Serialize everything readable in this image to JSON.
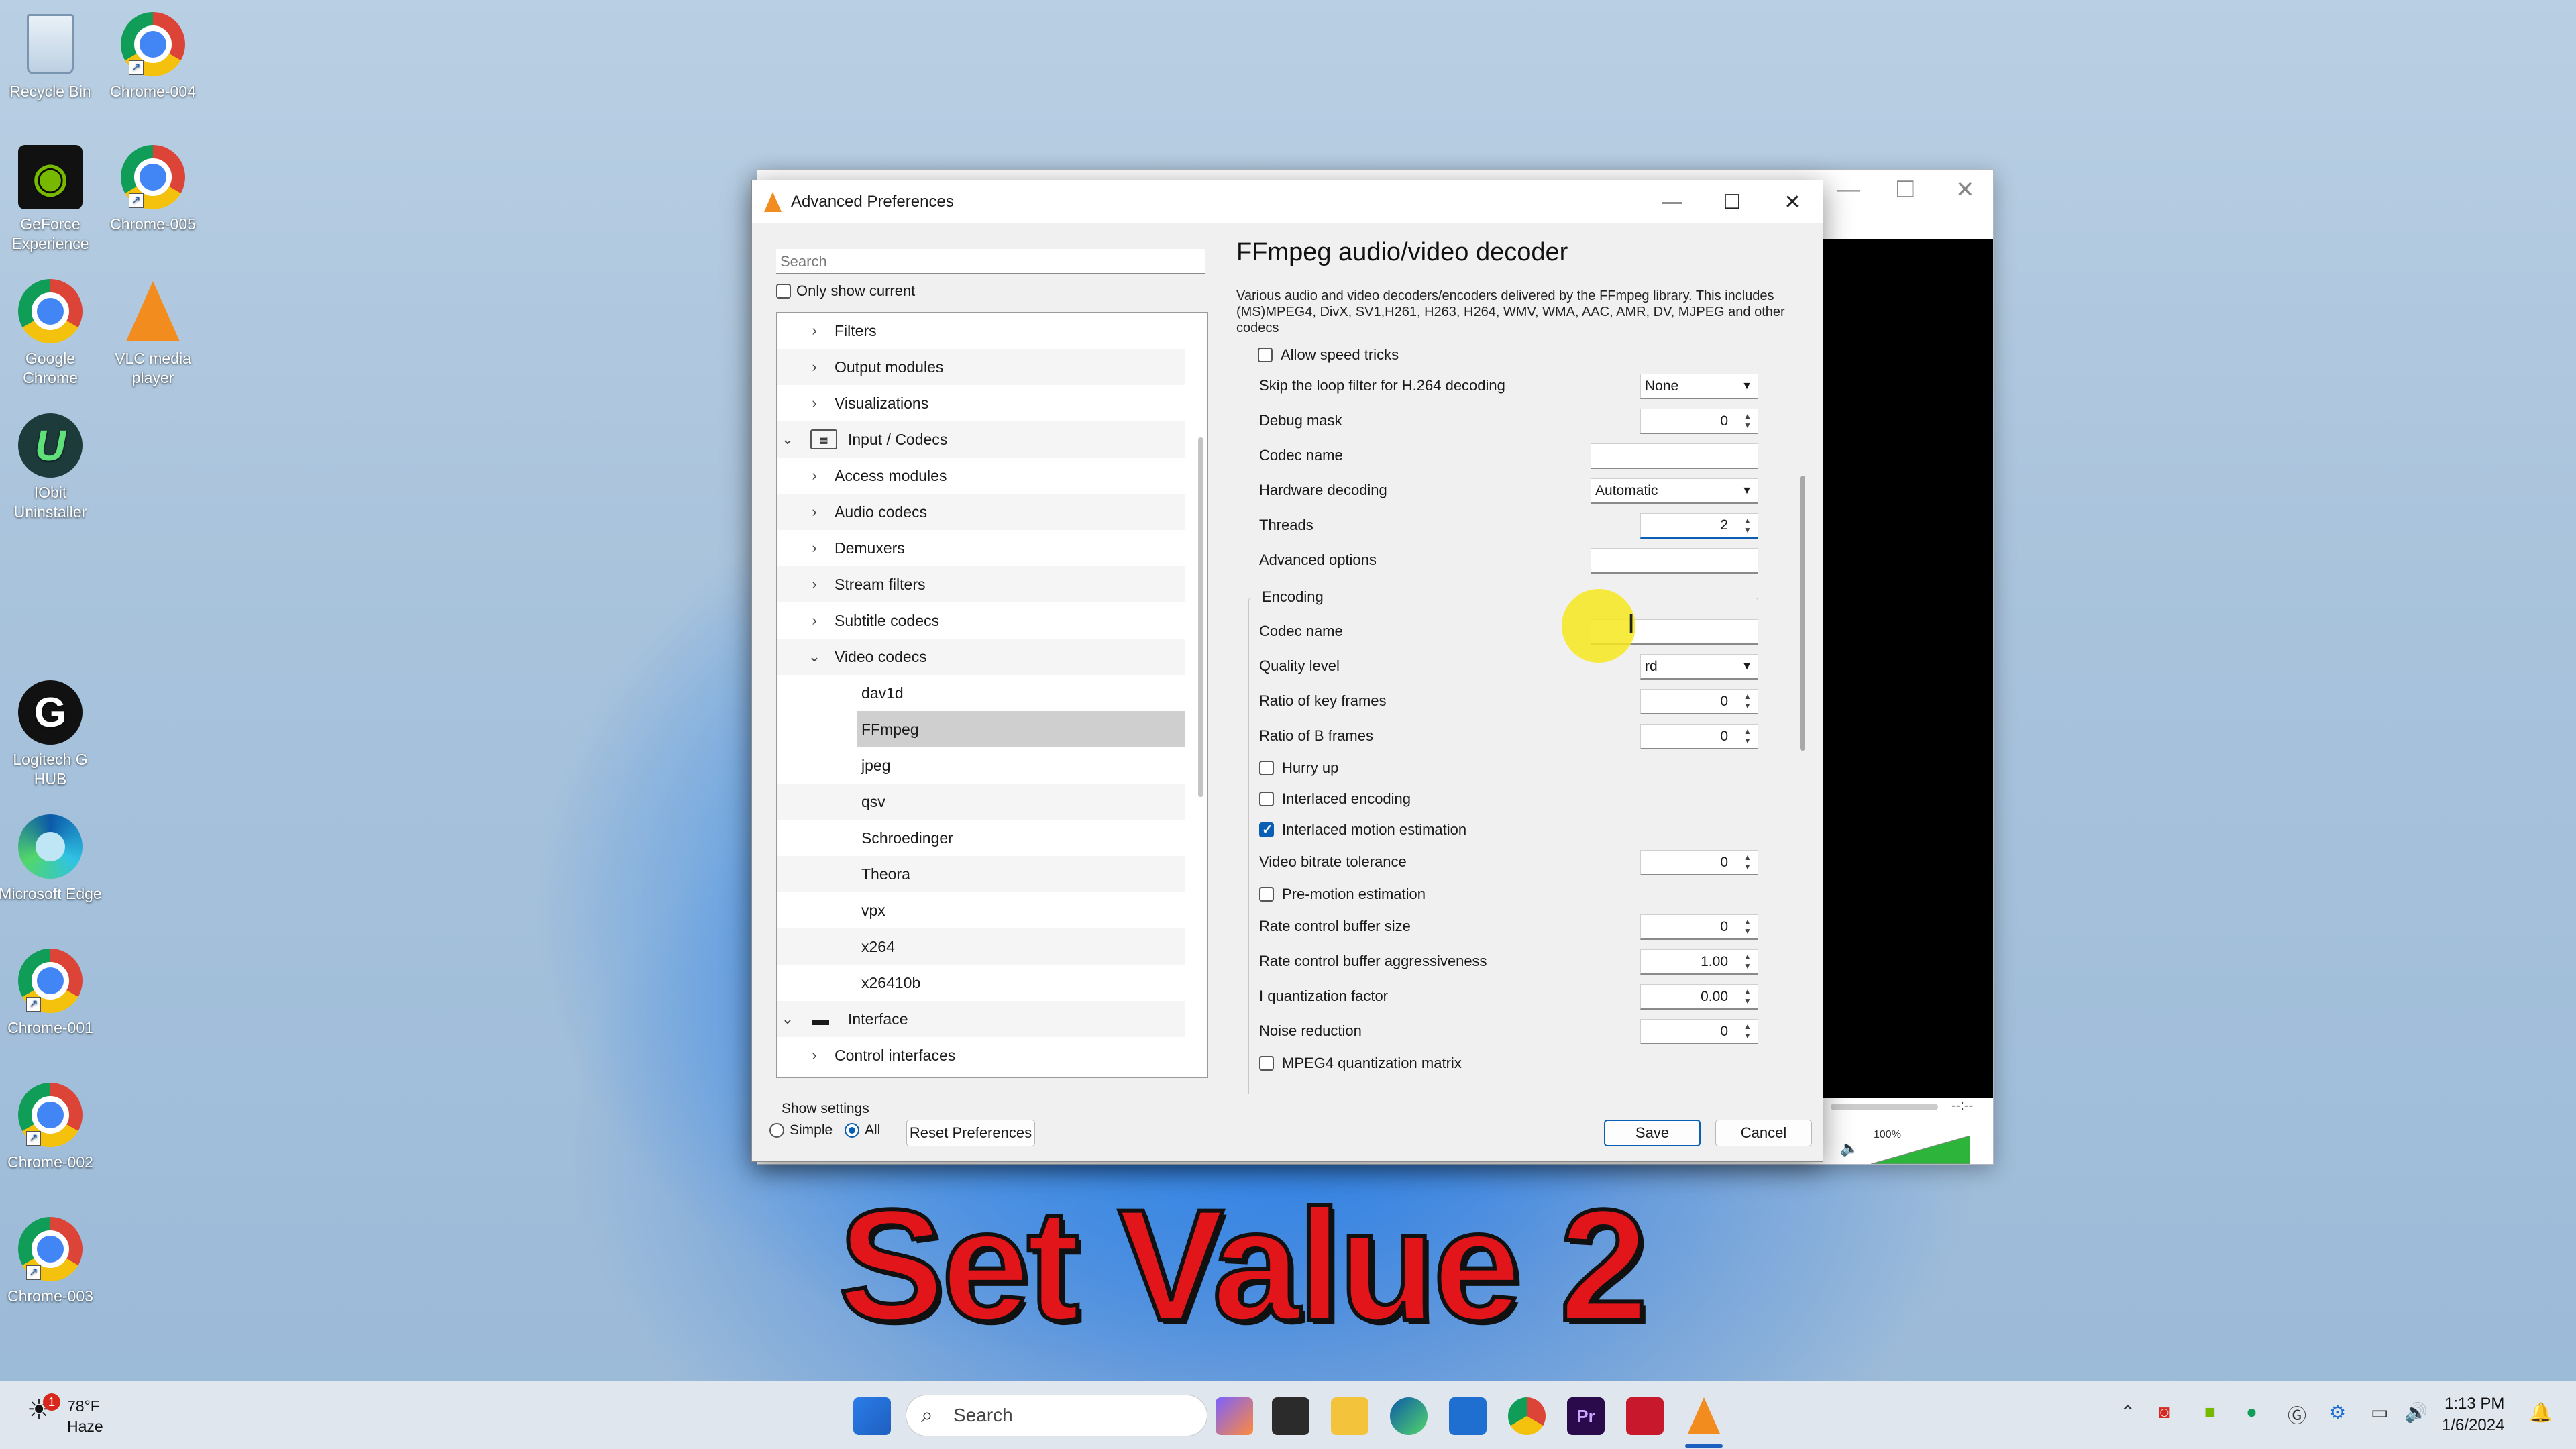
{
  "desktop": {
    "icons": [
      {
        "label": "Recycle Bin"
      },
      {
        "label": "Chrome-004"
      },
      {
        "label": "GeForce Experience"
      },
      {
        "label": "Chrome-005"
      },
      {
        "label": "Google Chrome"
      },
      {
        "label": "VLC media player"
      },
      {
        "label": "IObit Uninstaller"
      },
      {
        "label": "Logitech G HUB"
      },
      {
        "label": "Microsoft Edge"
      },
      {
        "label": "Chrome-001"
      },
      {
        "label": "Chrome-002"
      },
      {
        "label": "Chrome-003"
      }
    ]
  },
  "dialog": {
    "title": "Advanced Preferences",
    "search_placeholder": "Search",
    "only_show_current": "Only show current",
    "tree": [
      {
        "label": "Filters"
      },
      {
        "label": "Output modules"
      },
      {
        "label": "Visualizations"
      },
      {
        "label": "Input / Codecs"
      },
      {
        "label": "Access modules"
      },
      {
        "label": "Audio codecs"
      },
      {
        "label": "Demuxers"
      },
      {
        "label": "Stream filters"
      },
      {
        "label": "Subtitle codecs"
      },
      {
        "label": "Video codecs"
      },
      {
        "label": "dav1d"
      },
      {
        "label": "FFmpeg"
      },
      {
        "label": "jpeg"
      },
      {
        "label": "qsv"
      },
      {
        "label": "Schroedinger"
      },
      {
        "label": "Theora"
      },
      {
        "label": "vpx"
      },
      {
        "label": "x264"
      },
      {
        "label": "x26410b"
      },
      {
        "label": "Interface"
      },
      {
        "label": "Control interfaces"
      }
    ],
    "heading": "FFmpeg audio/video decoder",
    "description": "Various audio and video decoders/encoders delivered by the FFmpeg library. This includes (MS)MPEG4, DivX, SV1,H261, H263, H264, WMV, WMA, AAC, AMR, DV, MJPEG and other codecs",
    "settings": {
      "allow_speed_tricks": "Allow speed tricks",
      "skip_loop_filter": {
        "label": "Skip the loop filter for H.264 decoding",
        "value": "None"
      },
      "debug_mask": {
        "label": "Debug mask",
        "value": "0"
      },
      "codec_name": {
        "label": "Codec name",
        "value": ""
      },
      "hardware_decoding": {
        "label": "Hardware decoding",
        "value": "Automatic"
      },
      "threads": {
        "label": "Threads",
        "value": "2"
      },
      "advanced_options": {
        "label": "Advanced options",
        "value": ""
      },
      "encoding_title": "Encoding",
      "enc_codec_name": {
        "label": "Codec name",
        "value": ""
      },
      "quality_level": {
        "label": "Quality level",
        "value": "rd"
      },
      "ratio_key_frames": {
        "label": "Ratio of key frames",
        "value": "0"
      },
      "ratio_b_frames": {
        "label": "Ratio of B frames",
        "value": "0"
      },
      "hurry_up": {
        "label": "Hurry up",
        "checked": false
      },
      "interlaced_encoding": {
        "label": "Interlaced encoding",
        "checked": false
      },
      "interlaced_motion": {
        "label": "Interlaced motion estimation",
        "checked": true
      },
      "video_bitrate_tolerance": {
        "label": "Video bitrate tolerance",
        "value": "0"
      },
      "pre_motion": {
        "label": "Pre-motion estimation",
        "checked": false
      },
      "rc_buffer_size": {
        "label": "Rate control buffer size",
        "value": "0"
      },
      "rc_buffer_aggr": {
        "label": "Rate control buffer aggressiveness",
        "value": "1.00"
      },
      "i_quant_factor": {
        "label": "I quantization factor",
        "value": "0.00"
      },
      "noise_reduction": {
        "label": "Noise reduction",
        "value": "0"
      },
      "mpeg4_quant": {
        "label": "MPEG4 quantization matrix",
        "checked": false
      }
    },
    "show_settings": "Show settings",
    "simple": "Simple",
    "all": "All",
    "reset": "Reset Preferences",
    "save": "Save",
    "cancel": "Cancel"
  },
  "background_window": {
    "time_remaining": "--:--",
    "volume": "100%"
  },
  "caption": "Set Value 2",
  "taskbar": {
    "weather_temp": "78°F",
    "weather_desc": "Haze",
    "weather_badge": "1",
    "search_label": "Search",
    "time": "1:13 PM",
    "date": "1/6/2024"
  }
}
